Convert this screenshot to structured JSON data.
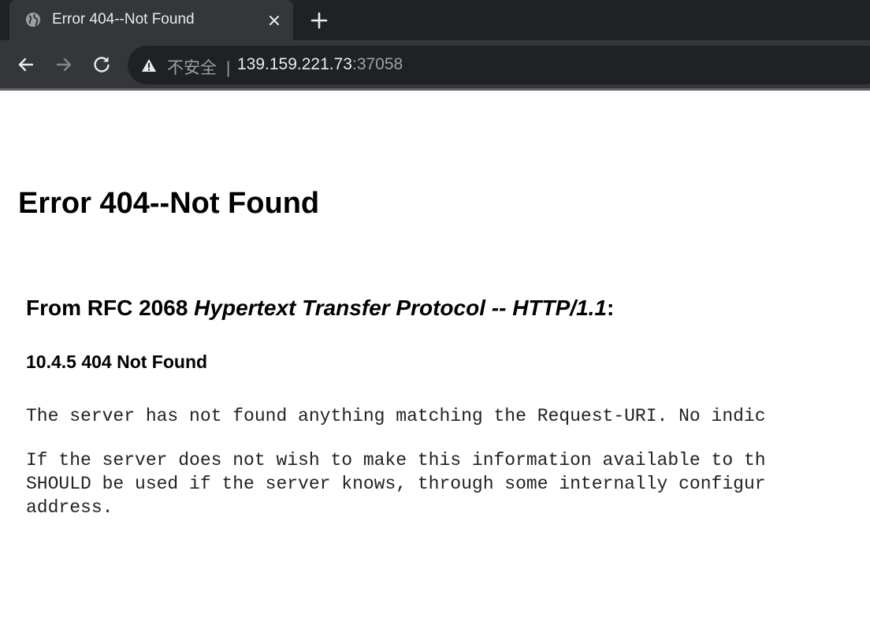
{
  "browser": {
    "tab": {
      "title": "Error 404--Not Found",
      "favicon": "globe-icon",
      "close_icon": "close-icon"
    },
    "new_tab_icon": "plus-icon",
    "nav": {
      "back_icon": "arrow-left-icon",
      "forward_icon": "arrow-right-icon",
      "reload_icon": "reload-icon"
    },
    "address_bar": {
      "security_icon": "warning-triangle-icon",
      "security_label": "不安全",
      "separator": "|",
      "host": "139.159.221.73",
      "port": ":37058"
    }
  },
  "page": {
    "title": "Error 404--Not Found",
    "rfc_heading": {
      "prefix": "From RFC 2068 ",
      "italic": "Hypertext Transfer Protocol -- HTTP/1.1",
      "suffix": ":"
    },
    "section_heading": "10.4.5 404 Not Found",
    "paragraph1": "The server has not found anything matching the Request-URI. No indic",
    "paragraph2_line1": "If the server does not wish to make this information available to th",
    "paragraph2_line2": "SHOULD be used if the server knows, through some internally configur",
    "paragraph2_line3": "address."
  },
  "colors": {
    "tabstrip_bg": "#202124",
    "toolbar_bg": "#35363a",
    "omnibox_bg": "#202124",
    "text_light": "#e8eaed",
    "text_dim": "#9aa0a6"
  }
}
